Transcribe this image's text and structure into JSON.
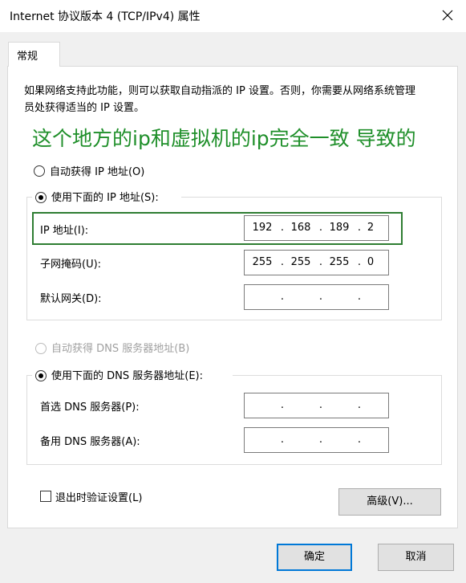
{
  "window": {
    "title": "Internet 协议版本 4 (TCP/IPv4) 属性"
  },
  "tabs": [
    {
      "label": "常规"
    }
  ],
  "description": "如果网络支持此功能，则可以获取自动指派的 IP 设置。否则，你需要从网络系统管理员处获得适当的 IP 设置。",
  "annotation": "这个地方的ip和虚拟机的ip完全一致 导致的",
  "ip": {
    "auto_label": "自动获得 IP 地址(O)",
    "manual_label": "使用下面的 IP 地址(S):",
    "selected": "manual",
    "address_label": "IP 地址(I):",
    "address": [
      "192",
      "168",
      "189",
      "2"
    ],
    "mask_label": "子网掩码(U):",
    "mask": [
      "255",
      "255",
      "255",
      "0"
    ],
    "gateway_label": "默认网关(D):",
    "gateway": [
      "",
      "",
      "",
      ""
    ]
  },
  "dns": {
    "auto_label": "自动获得 DNS 服务器地址(B)",
    "manual_label": "使用下面的 DNS 服务器地址(E):",
    "selected": "manual",
    "preferred_label": "首选 DNS 服务器(P):",
    "preferred": [
      "",
      "",
      "",
      ""
    ],
    "alternate_label": "备用 DNS 服务器(A):",
    "alternate": [
      "",
      "",
      "",
      ""
    ]
  },
  "validate": {
    "label": "退出时验证设置(L)",
    "checked": false
  },
  "buttons": {
    "advanced": "高级(V)...",
    "ok": "确定",
    "cancel": "取消"
  },
  "colors": {
    "annotation": "#1f8f2a",
    "highlight_border": "#2e7d32",
    "default_button_border": "#0078d7"
  }
}
